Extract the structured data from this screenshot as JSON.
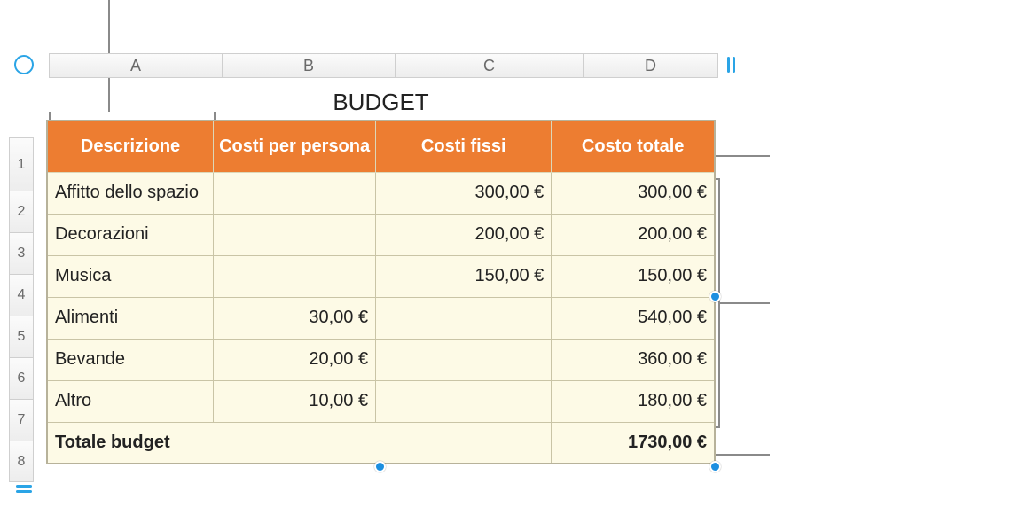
{
  "columns": [
    "A",
    "B",
    "C",
    "D"
  ],
  "row_numbers": [
    "1",
    "2",
    "3",
    "4",
    "5",
    "6",
    "7",
    "8"
  ],
  "table_title": "BUDGET",
  "headers": {
    "col1": "Descrizione",
    "col2": "Costi per persona",
    "col3": "Costi fissi",
    "col4": "Costo totale"
  },
  "rows": [
    {
      "descrizione": "Affitto dello spazio",
      "costi_persona": "",
      "costi_fissi": "300,00 €",
      "costo_totale": "300,00 €"
    },
    {
      "descrizione": "Decorazioni",
      "costi_persona": "",
      "costi_fissi": "200,00 €",
      "costo_totale": "200,00 €"
    },
    {
      "descrizione": "Musica",
      "costi_persona": "",
      "costi_fissi": "150,00 €",
      "costo_totale": "150,00 €"
    },
    {
      "descrizione": "Alimenti",
      "costi_persona": "30,00 €",
      "costi_fissi": "",
      "costo_totale": "540,00 €"
    },
    {
      "descrizione": "Bevande",
      "costi_persona": "20,00 €",
      "costi_fissi": "",
      "costo_totale": "360,00 €"
    },
    {
      "descrizione": "Altro",
      "costi_persona": "10,00 €",
      "costi_fissi": "",
      "costo_totale": "180,00 €"
    }
  ],
  "footer": {
    "label": "Totale budget",
    "total": "1730,00 €"
  },
  "chart_data": {
    "type": "table",
    "title": "BUDGET",
    "columns": [
      "Descrizione",
      "Costi per persona",
      "Costi fissi",
      "Costo totale"
    ],
    "rows": [
      [
        "Affitto dello spazio",
        null,
        300.0,
        300.0
      ],
      [
        "Decorazioni",
        null,
        200.0,
        200.0
      ],
      [
        "Musica",
        null,
        150.0,
        150.0
      ],
      [
        "Alimenti",
        30.0,
        null,
        540.0
      ],
      [
        "Bevande",
        20.0,
        null,
        360.0
      ],
      [
        "Altro",
        10.0,
        null,
        180.0
      ]
    ],
    "footer": [
      "Totale budget",
      null,
      null,
      1730.0
    ],
    "currency": "€"
  }
}
